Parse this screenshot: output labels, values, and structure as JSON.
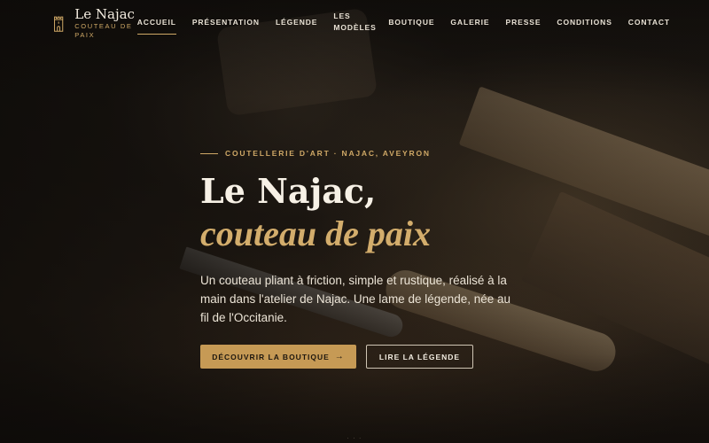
{
  "brand": {
    "name": "Le Najac",
    "tagline": "COUTEAU DE PAIX",
    "logo_icon": "tower-icon"
  },
  "nav": {
    "items": [
      {
        "label": "ACCUEIL",
        "active": true
      },
      {
        "label": "PRÉSENTATION"
      },
      {
        "label": "LÉGENDE"
      },
      {
        "label": "LES MODÈLES"
      },
      {
        "label": "BOUTIQUE"
      },
      {
        "label": "GALERIE"
      },
      {
        "label": "PRESSE"
      },
      {
        "label": "CONDITIONS"
      },
      {
        "label": "CONTACT"
      }
    ]
  },
  "hero": {
    "eyebrow": "COUTELLERIE D'ART · NAJAC, AVEYRON",
    "title_line1": "Le Najac,",
    "title_line2": "couteau de paix",
    "lead": "Un couteau pliant à friction, simple et rustique, réalisé à la main dans l'atelier de Najac. Une lame de légende, née au fil de l'Occitanie.",
    "primary_button": "DÉCOUVRIR LA BOUTIQUE",
    "primary_icon": "arrow-right-icon",
    "secondary_button": "LIRE LA LÉGENDE"
  },
  "colors": {
    "accent": "#c69a55",
    "background": "#16120e",
    "text": "#efe7da"
  }
}
